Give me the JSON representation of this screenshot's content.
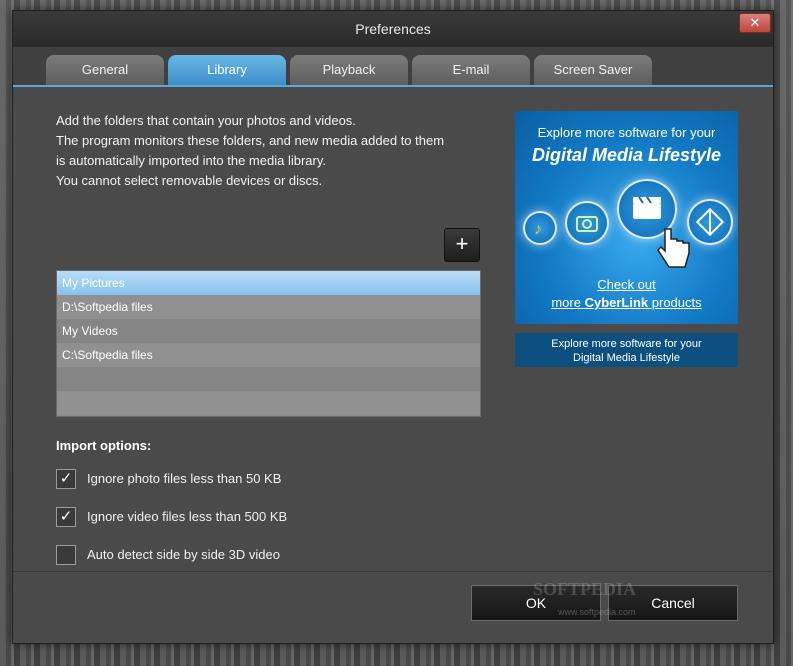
{
  "window": {
    "title": "Preferences",
    "close_label": "✕"
  },
  "tabs": [
    {
      "label": "General",
      "active": false
    },
    {
      "label": "Library",
      "active": true
    },
    {
      "label": "Playback",
      "active": false
    },
    {
      "label": "E-mail",
      "active": false
    },
    {
      "label": "Screen Saver",
      "active": false
    }
  ],
  "description": [
    "Add the folders that contain your photos and videos.",
    "The program monitors these folders, and new media added to them",
    "is automatically imported into the media library.",
    "You cannot select removable devices or discs."
  ],
  "add_button": "+",
  "folders": [
    {
      "label": "My Pictures",
      "selected": true
    },
    {
      "label": "D:\\Softpedia files",
      "selected": false
    },
    {
      "label": "My Videos",
      "selected": false
    },
    {
      "label": "C:\\Softpedia files",
      "selected": false
    },
    {
      "label": "",
      "selected": false
    },
    {
      "label": "",
      "selected": false
    }
  ],
  "ad": {
    "line1": "Explore more software for your",
    "line2": "Digital Media Lifestyle",
    "link1": "Check out",
    "link2_prefix": "more ",
    "link2_brand": "CyberLink",
    "link2_suffix": " products",
    "caption_line1": "Explore more software for your",
    "caption_line2": "Digital Media Lifestyle"
  },
  "import": {
    "title": "Import options:",
    "options": [
      {
        "label": "Ignore photo files less than 50 KB",
        "checked": true
      },
      {
        "label": "Ignore video files less than 500 KB",
        "checked": true
      },
      {
        "label": "Auto detect side by side 3D video",
        "checked": false
      }
    ]
  },
  "buttons": {
    "ok": "OK",
    "cancel": "Cancel"
  },
  "watermark": {
    "main": "SOFTPEDIA",
    "sub": "www.softpedia.com"
  },
  "colors": {
    "accent": "#3d8fc9",
    "selection": "#9fd0f3",
    "ad_blue": "#1279c4"
  }
}
